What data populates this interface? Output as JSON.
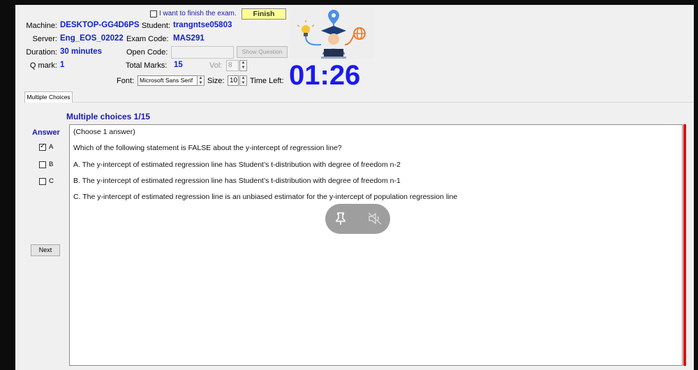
{
  "header": {
    "finish_checkbox_label": "I want to finish the exam.",
    "finish_button": "Finish",
    "machine_label": "Machine:",
    "machine_value": "DESKTOP-GG4D6PS",
    "student_label": "Student:",
    "student_value": "trangntse05803",
    "server_label": "Server:",
    "server_value": "Eng_EOS_02022",
    "exam_code_label": "Exam Code:",
    "exam_code_value": "MAS291",
    "duration_label": "Duration:",
    "duration_value": "30 minutes",
    "open_code_label": "Open Code:",
    "open_code_value": "",
    "show_question_button": "Show Question",
    "qmark_label": "Q mark:",
    "qmark_value": "1",
    "total_marks_label": "Total Marks:",
    "total_marks_value": "15",
    "vol_label": "Vol:",
    "vol_value": "8",
    "font_label": "Font:",
    "font_value": "Microsoft Sans Serif",
    "size_label": "Size:",
    "size_value": "10",
    "time_left_label": "Time Left:",
    "time_left_value": "01:26"
  },
  "tabs": [
    {
      "label": "Multiple Choices"
    }
  ],
  "question": {
    "heading": "Multiple choices 1/15",
    "answer_label": "Answer",
    "choose_hint": "(Choose 1 answer)",
    "text": "Which of the following statement is FALSE about the y-intercept of regression line?",
    "options": [
      {
        "label": "A",
        "checked": true,
        "text": "A.  The y-intercept of estimated regression line has Student’s t-distribution with degree of freedom n-2"
      },
      {
        "label": "B",
        "checked": false,
        "text": "B.  The y-intercept of estimated regression line has Student’s t-distribution with degree of freedom n-1"
      },
      {
        "label": "C",
        "checked": false,
        "text": "C.  The y-intercept of estimated regression line is an unbiased estimator for the y-intercept of population regression line"
      }
    ],
    "next_button": "Next"
  },
  "overlay": {
    "icons": [
      "pin-icon",
      "mute-icon"
    ]
  },
  "colors": {
    "accent": "#1a1aee",
    "label_blue": "#1122cc",
    "finish_bg": "#ffff99",
    "scroll_red": "#e01010"
  }
}
